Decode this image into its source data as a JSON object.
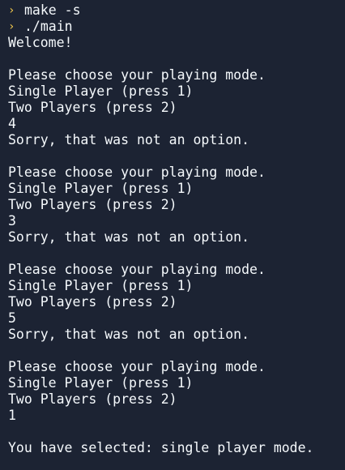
{
  "terminal": {
    "prompt_glyph": "›",
    "commands": [
      "make -s",
      "./main"
    ],
    "output": [
      "Welcome!",
      "",
      "Please choose your playing mode.",
      "Single Player (press 1)",
      "Two Players (press 2)",
      "4",
      "Sorry, that was not an option.",
      "",
      "Please choose your playing mode.",
      "Single Player (press 1)",
      "Two Players (press 2)",
      "3",
      "Sorry, that was not an option.",
      "",
      "Please choose your playing mode.",
      "Single Player (press 1)",
      "Two Players (press 2)",
      "5",
      "Sorry, that was not an option.",
      "",
      "Please choose your playing mode.",
      "Single Player (press 1)",
      "Two Players (press 2)",
      "1",
      "",
      "You have selected: single player mode."
    ]
  },
  "colors": {
    "background": "#1c2333",
    "text": "#f5f9fc",
    "prompt": "#f2c94c"
  }
}
